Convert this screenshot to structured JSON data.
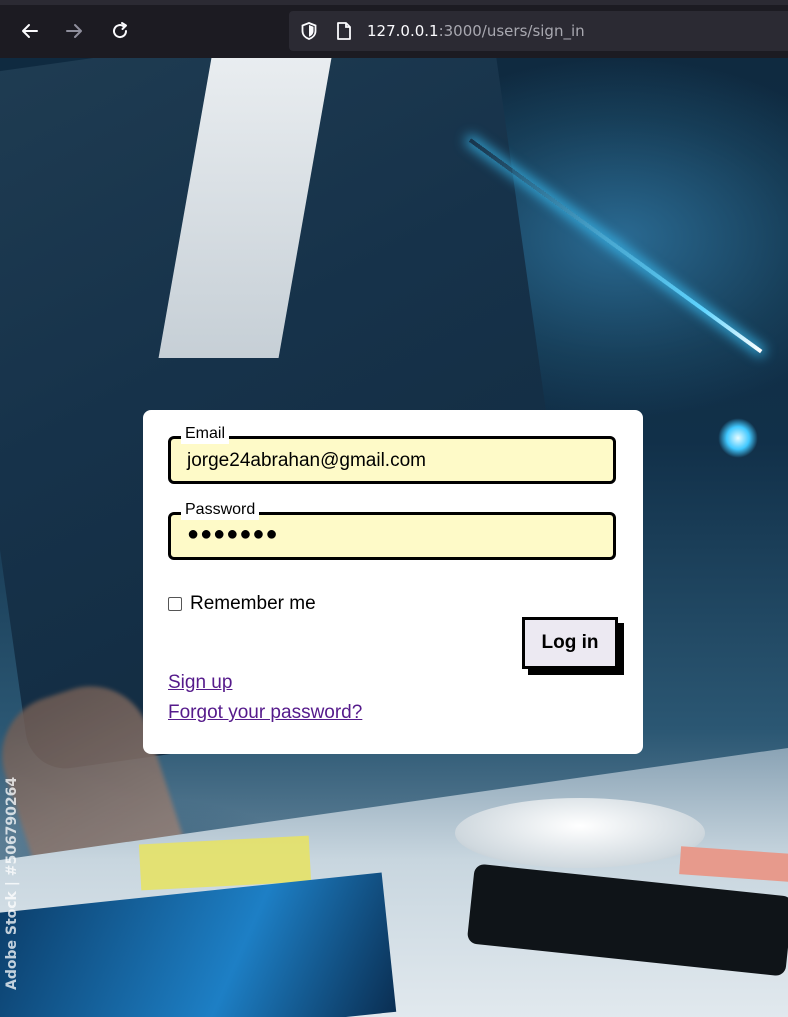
{
  "browser": {
    "back_icon": "arrow-left-icon",
    "forward_icon": "arrow-right-icon",
    "reload_icon": "reload-icon",
    "shield_icon": "shield-icon",
    "page_icon": "page-icon",
    "url_host": "127.0.0.1",
    "url_rest": ":3000/users/sign_in"
  },
  "background": {
    "watermark": "Adobe Stock | #506790264"
  },
  "login": {
    "email_label": "Email",
    "email_value": "jorge24abrahan@gmail.com",
    "password_label": "Password",
    "password_masked": "●●●●●●●",
    "remember_label": "Remember me",
    "remember_checked": false,
    "submit_label": "Log in",
    "signup_link": "Sign up",
    "forgot_link": "Forgot your password?"
  },
  "colors": {
    "field_bg": "#fefac8",
    "link": "#551a8b",
    "button_bg": "#ece9f2"
  }
}
